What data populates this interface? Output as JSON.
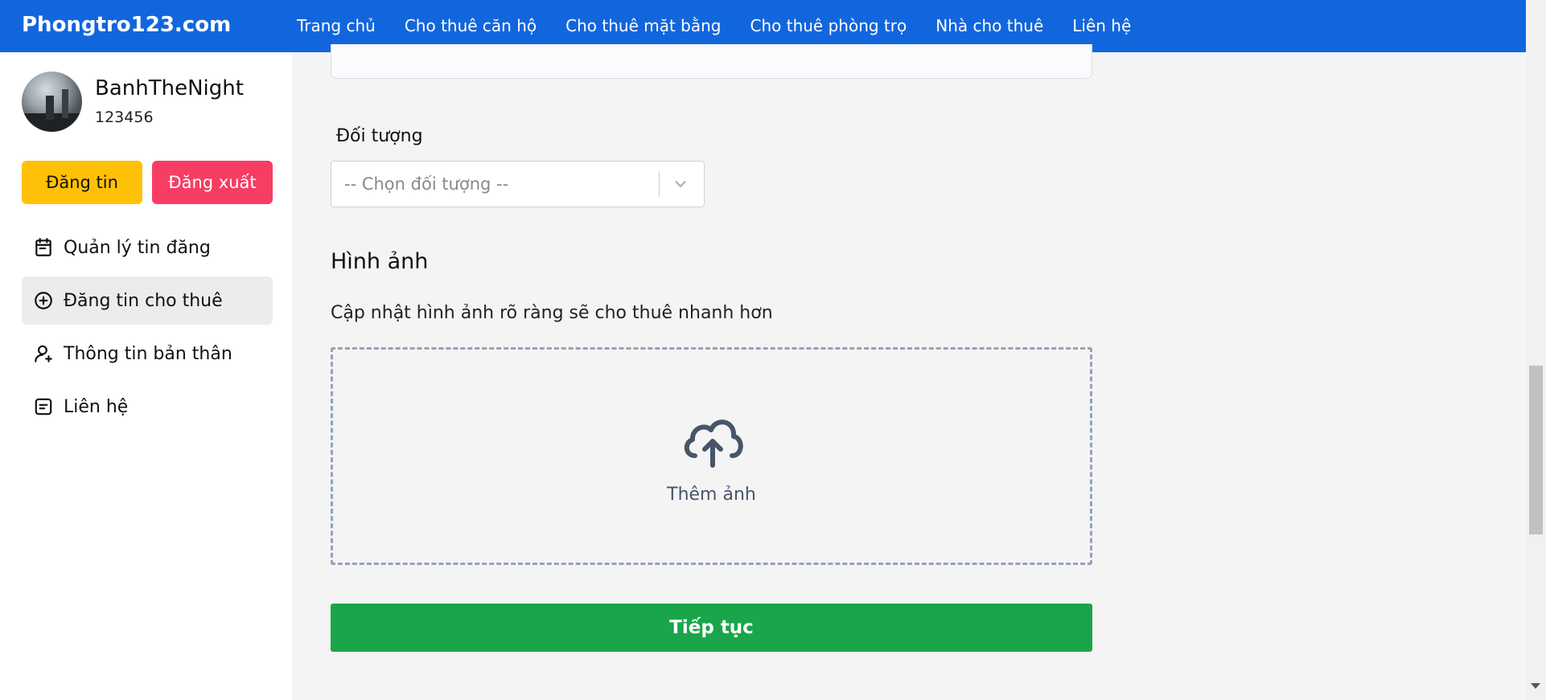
{
  "header": {
    "logo": "Phongtro123.com",
    "nav": [
      "Trang chủ",
      "Cho thuê căn hộ",
      "Cho thuê mặt bằng",
      "Cho thuê phòng trọ",
      "Nhà cho thuê",
      "Liên hệ"
    ],
    "bg_color": "#1266dd"
  },
  "sidebar": {
    "username": "BanhTheNight",
    "user_id": "123456",
    "post_button": "Đăng tin",
    "logout_button": "Đăng xuất",
    "menu": [
      {
        "label": "Quản lý tin đăng",
        "icon": "calendar-icon"
      },
      {
        "label": "Đăng tin cho thuê",
        "icon": "plus-circle-icon",
        "active": true
      },
      {
        "label": "Thông tin bản thân",
        "icon": "user-icon"
      },
      {
        "label": "Liên hệ",
        "icon": "message-icon"
      }
    ]
  },
  "main": {
    "target_label": "Đối tượng",
    "target_placeholder": "-- Chọn đối tượng --",
    "images_heading": "Hình ảnh",
    "images_desc": "Cập nhật hình ảnh rõ ràng sẽ cho thuê nhanh hơn",
    "upload_label": "Thêm ảnh",
    "continue_button": "Tiếp tục"
  },
  "colors": {
    "post_button": "#ffc107",
    "logout_button": "#f73d63",
    "continue_button": "#1aa54a"
  }
}
